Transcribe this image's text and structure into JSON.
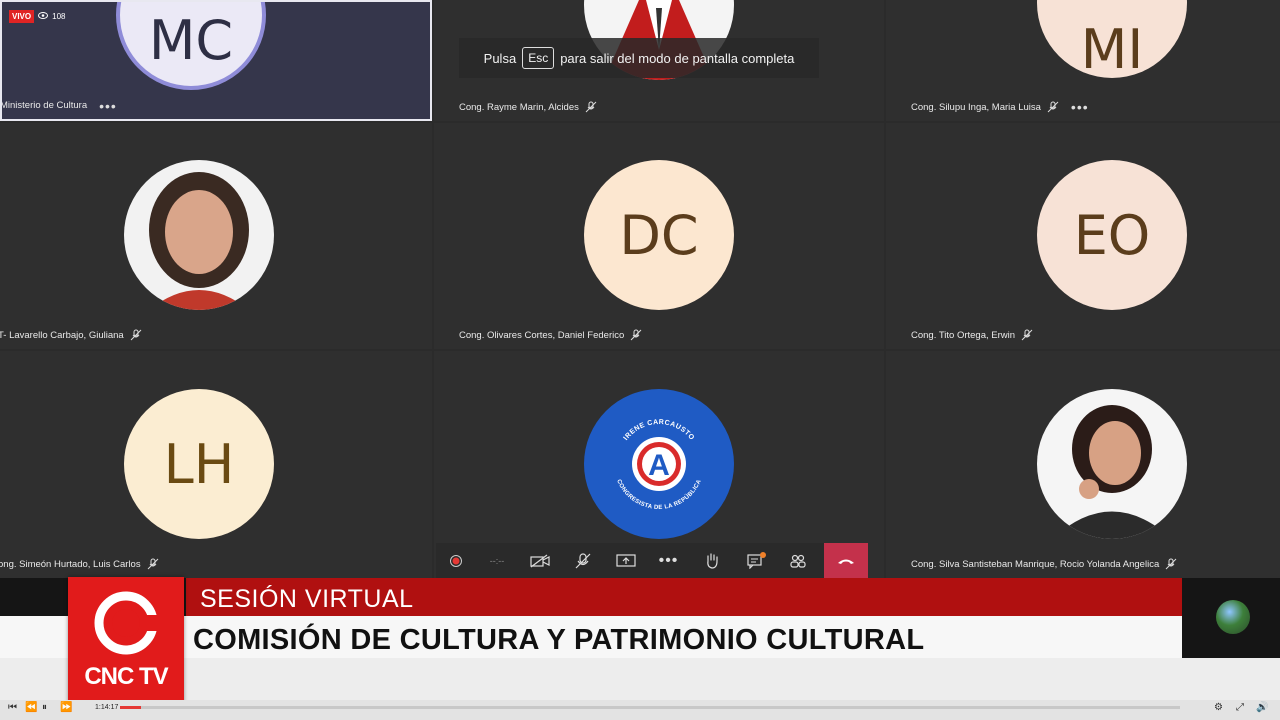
{
  "live": {
    "badge": "VIVO",
    "viewers": "108"
  },
  "toast": {
    "before": "Pulsa",
    "key": "Esc",
    "after": "para salir del modo de pantalla completa"
  },
  "tiles": [
    {
      "initials": "MC",
      "name": "Ministerio de Cultura"
    },
    {
      "name": "Cong. Rayme Marin, Alcides"
    },
    {
      "initials": "MI",
      "name": "Cong. Silupu Inga, Maria Luisa"
    },
    {
      "name": "T- Lavarello Carbajo, Giuliana"
    },
    {
      "initials": "DC",
      "name": "Cong. Olivares Cortes, Daniel Federico"
    },
    {
      "initials": "EO",
      "name": "Cong. Tito Ortega, Erwin"
    },
    {
      "initials": "LH",
      "name": "ong. Simeón Hurtado, Luis Carlos"
    },
    {
      "logo_text": "A",
      "ring_top": "IRENE CARCAUSTO",
      "ring_bottom": "CONGRESISTA DE LA REPÚBLICA"
    },
    {
      "name": "Cong. Silva Santisteban Manrique, Rocio Yolanda Angelica"
    }
  ],
  "callbar": {
    "timer": "--:--"
  },
  "lower_third": {
    "kicker": "SESIÓN VIRTUAL",
    "headline": "COMISIÓN DE CULTURA Y PATRIMONIO CULTURAL"
  },
  "logo": {
    "text": "CNC TV"
  },
  "player": {
    "time": "1:14:17",
    "progress": 0.02
  },
  "colors": {
    "red": "#b01010",
    "logo_red": "#e11b1b",
    "hangup": "#c4314b"
  }
}
